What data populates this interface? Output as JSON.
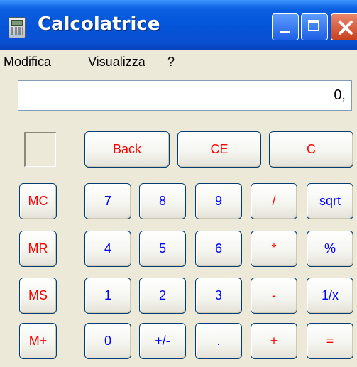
{
  "window": {
    "title": "Calcolatrice"
  },
  "menu": {
    "items": [
      "Modifica",
      "Visualizza",
      "?"
    ]
  },
  "display": {
    "value": "0,"
  },
  "buttons": {
    "back": "Back",
    "ce": "CE",
    "c": "C",
    "mc": "MC",
    "mr": "MR",
    "ms": "MS",
    "mplus": "M+",
    "d7": "7",
    "d8": "8",
    "d9": "9",
    "d4": "4",
    "d5": "5",
    "d6": "6",
    "d1": "1",
    "d2": "2",
    "d3": "3",
    "d0": "0",
    "sign": "+/-",
    "dot": ".",
    "div": "/",
    "mul": "*",
    "sub": "-",
    "add": "+",
    "sqrt": "sqrt",
    "pct": "%",
    "inv": "1/x",
    "eq": "="
  },
  "colors": {
    "operator_text": "#ff0000",
    "digit_text": "#0000ff",
    "title_bar": "#0454d8"
  }
}
